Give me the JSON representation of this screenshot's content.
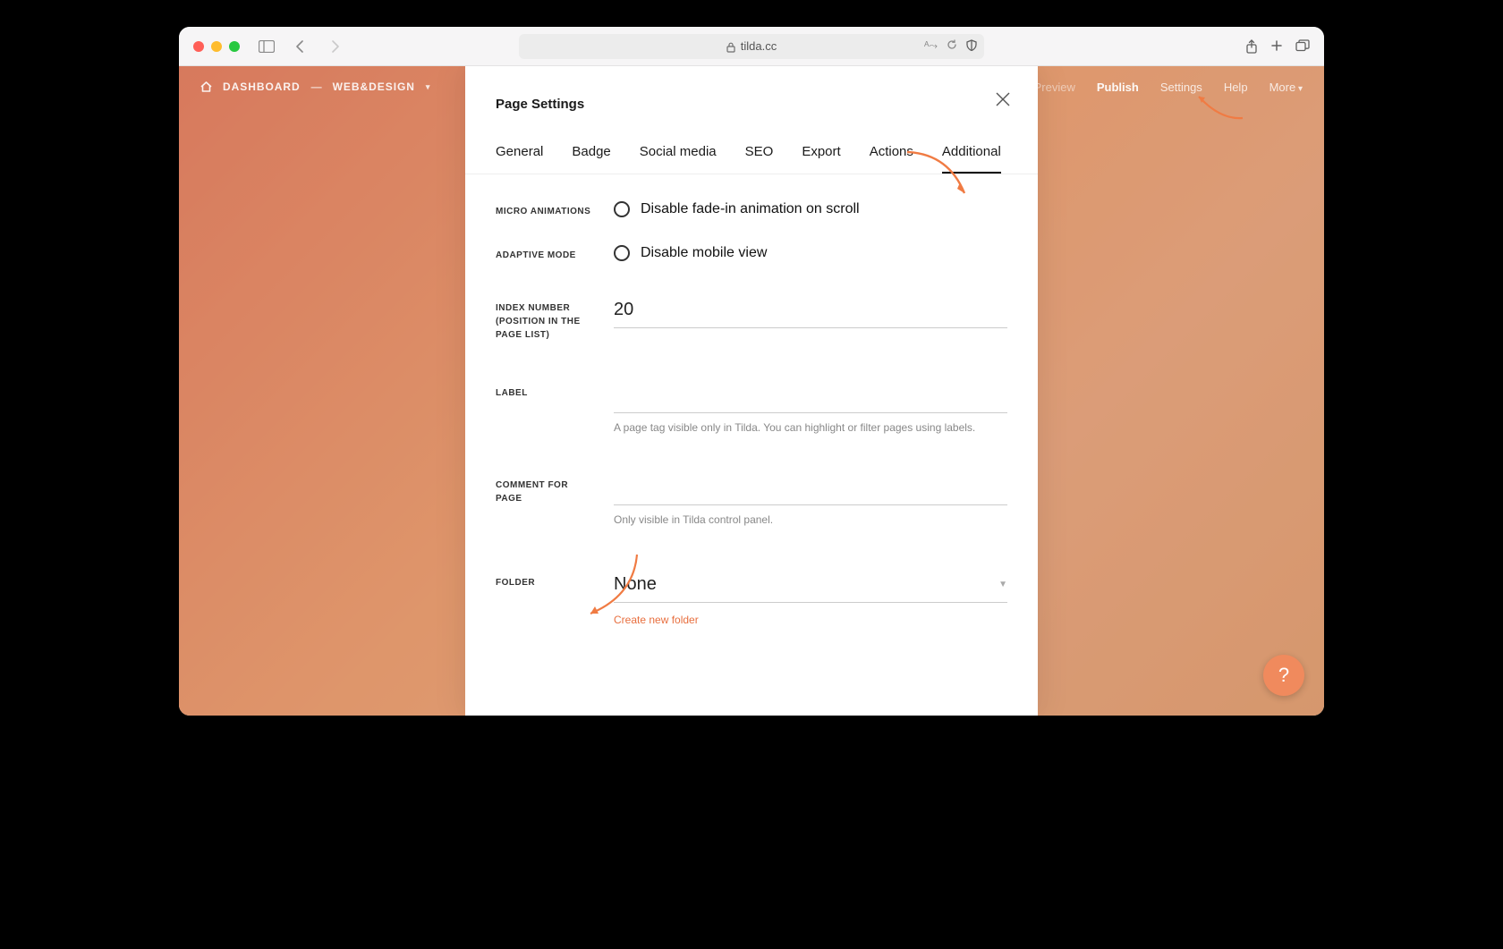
{
  "browser": {
    "url_host": "tilda.cc"
  },
  "topbar": {
    "dashboard": "DASHBOARD",
    "project": "WEB&DESIGN",
    "preview": "Preview",
    "publish": "Publish",
    "settings": "Settings",
    "help": "Help",
    "more": "More"
  },
  "modal": {
    "title": "Page Settings",
    "tabs": {
      "general": "General",
      "badge": "Badge",
      "social": "Social media",
      "seo": "SEO",
      "export": "Export",
      "actions": "Actions",
      "additional": "Additional"
    },
    "fields": {
      "micro_animations": {
        "label": "MICRO ANIMATIONS",
        "option": "Disable fade-in animation on scroll"
      },
      "adaptive_mode": {
        "label": "ADAPTIVE MODE",
        "option": "Disable mobile view"
      },
      "index_number": {
        "label": "INDEX NUMBER (POSITION IN THE PAGE LIST)",
        "value": "20"
      },
      "page_label": {
        "label": "LABEL",
        "value": "",
        "hint": "A page tag visible only in Tilda. You can highlight or filter pages using labels."
      },
      "comment": {
        "label": "COMMENT FOR PAGE",
        "value": "",
        "hint": "Only visible in Tilda control panel."
      },
      "folder": {
        "label": "FOLDER",
        "value": "None",
        "create_link": "Create new folder"
      }
    }
  },
  "help_fab": "?"
}
